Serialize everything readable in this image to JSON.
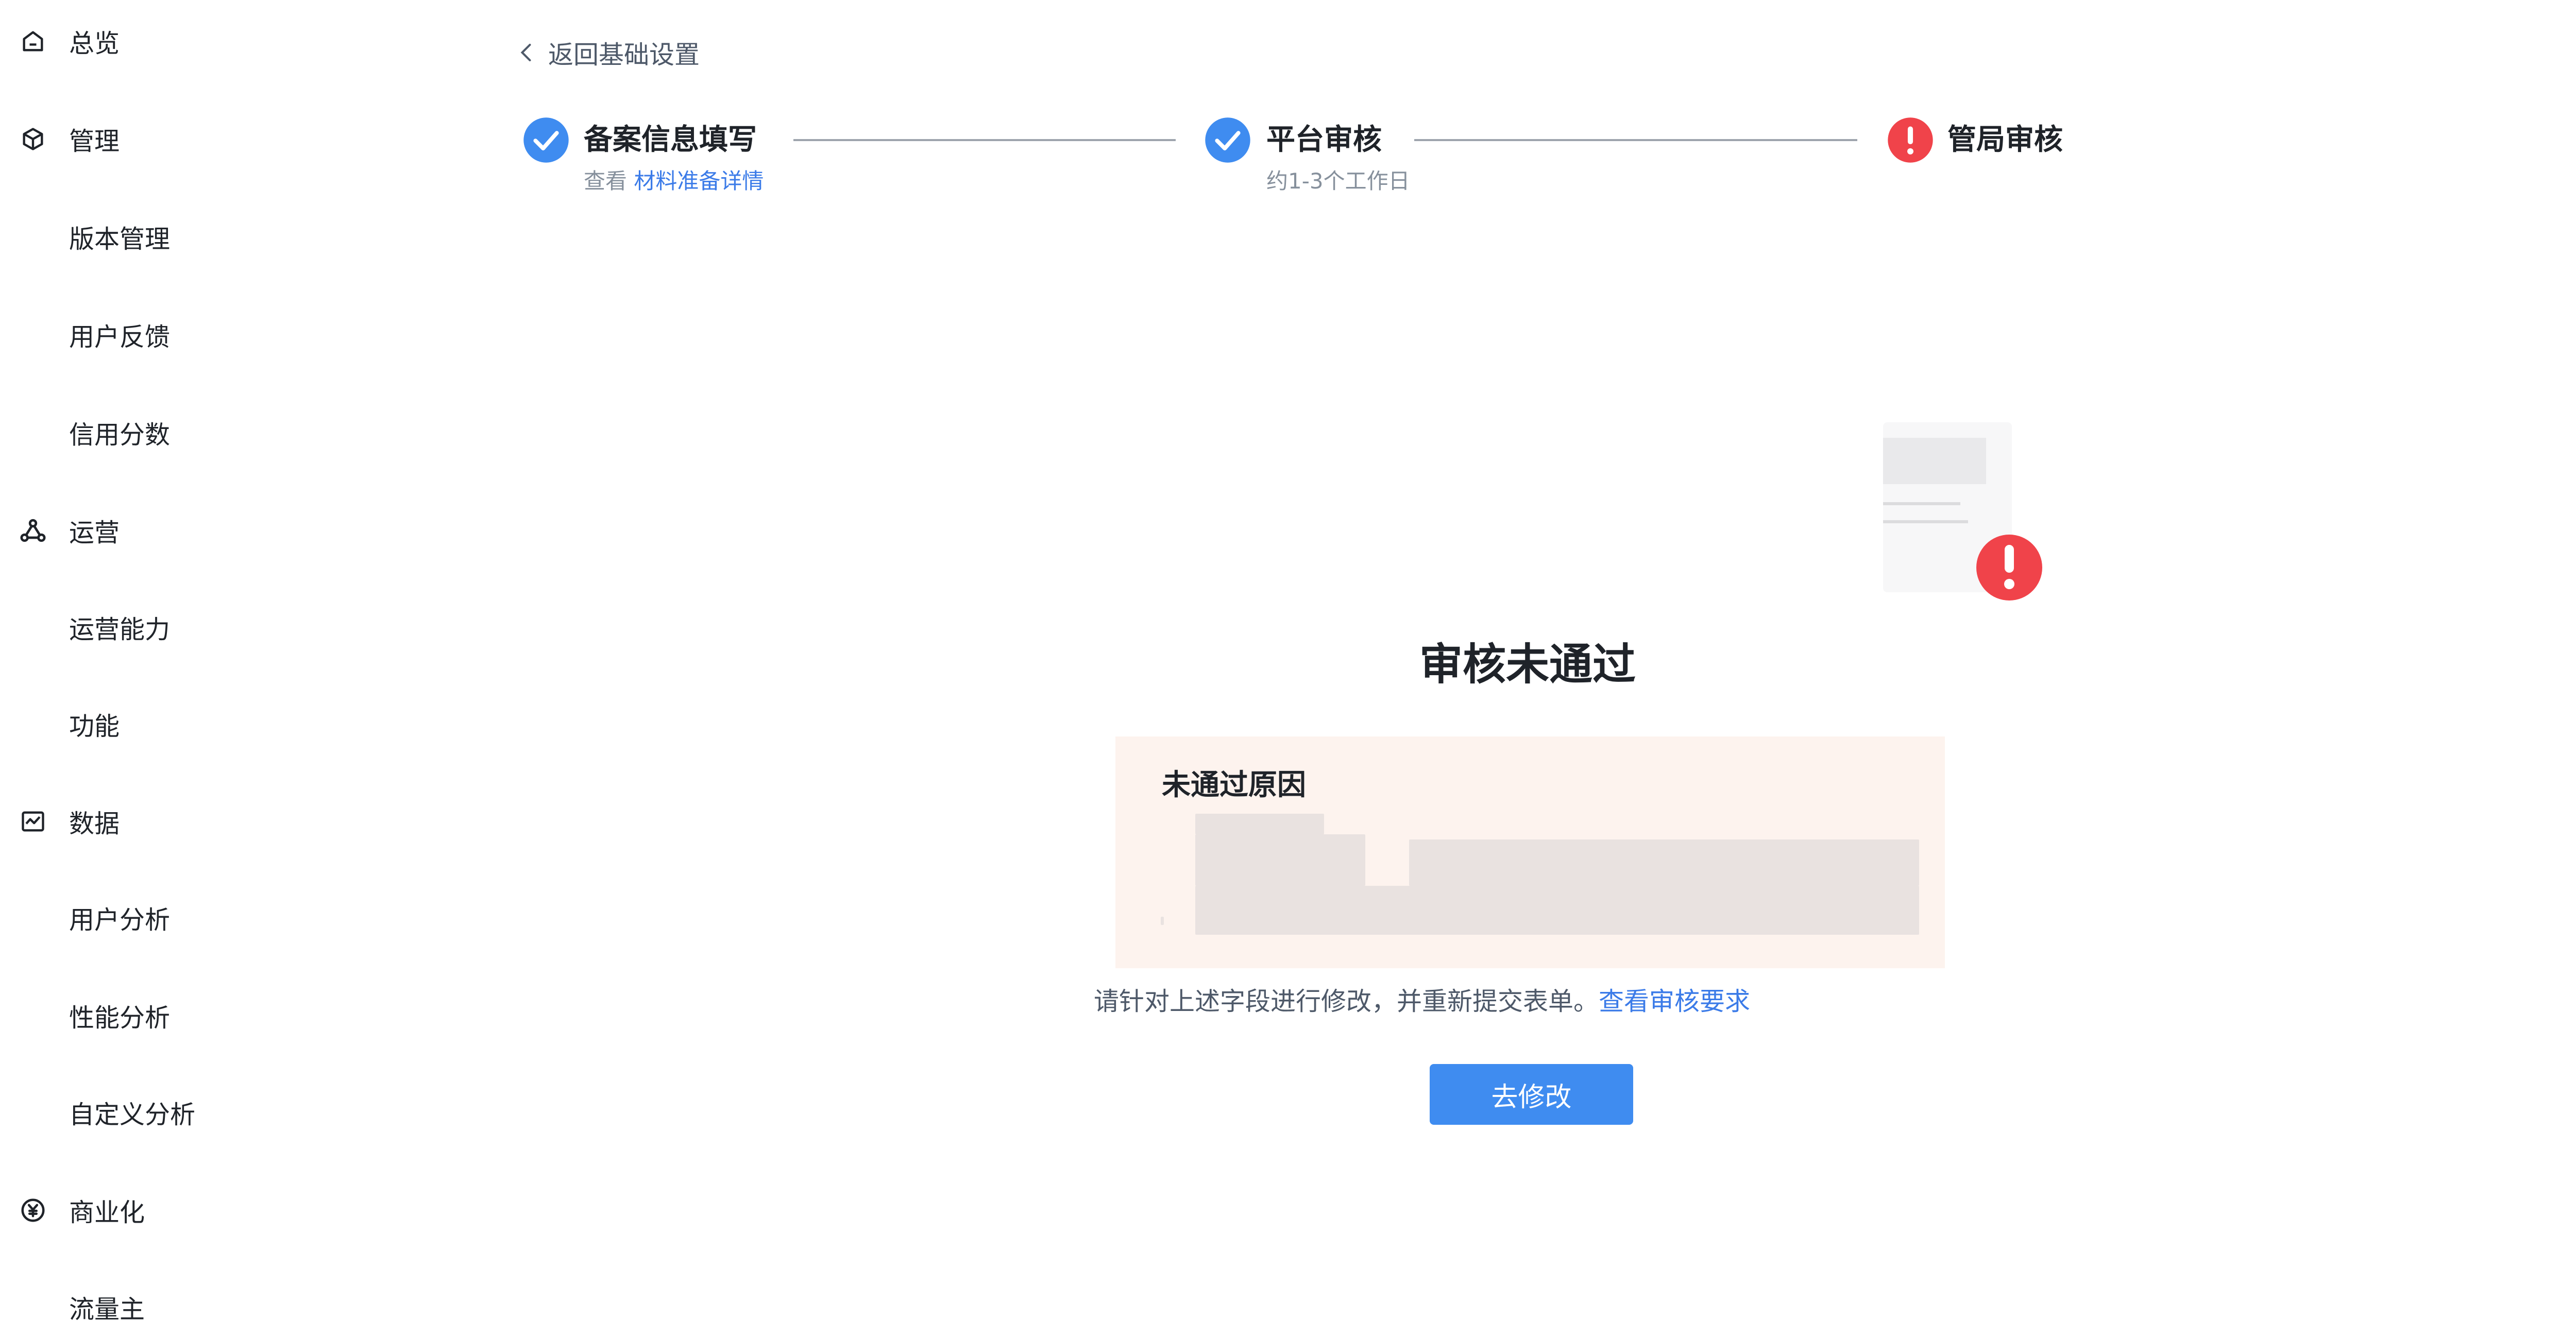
{
  "sidebar": {
    "items": [
      {
        "label": "总览",
        "icon": "home-icon"
      },
      {
        "label": "管理",
        "icon": "cube-icon"
      },
      {
        "label": "版本管理",
        "icon": ""
      },
      {
        "label": "用户反馈",
        "icon": ""
      },
      {
        "label": "信用分数",
        "icon": ""
      },
      {
        "label": "运营",
        "icon": "operation-icon"
      },
      {
        "label": "运营能力",
        "icon": ""
      },
      {
        "label": "功能",
        "icon": ""
      },
      {
        "label": "数据",
        "icon": "chart-icon"
      },
      {
        "label": "用户分析",
        "icon": ""
      },
      {
        "label": "性能分析",
        "icon": ""
      },
      {
        "label": "自定义分析",
        "icon": ""
      },
      {
        "label": "商业化",
        "icon": "yuan-icon"
      },
      {
        "label": "流量主",
        "icon": ""
      }
    ]
  },
  "main": {
    "back_label": "返回基础设置",
    "steps": [
      {
        "title": "备案信息填写",
        "sub_prefix": "查看 ",
        "sub_link": "材料准备详情",
        "status": "done"
      },
      {
        "title": "平台审核",
        "sub": "约1-3个工作日",
        "status": "done"
      },
      {
        "title": "管局审核",
        "status": "error"
      }
    ],
    "result_title": "审核未通过",
    "reason": {
      "title": "未通过原因",
      "content": "[redacted]"
    },
    "hint_text": "请针对上述字段进行修改，并重新提交表单。",
    "hint_link": "查看审核要求",
    "action_label": "去修改"
  },
  "colors": {
    "accent": "#3f8cf0",
    "link": "#3b7be8",
    "success_step": "#3f8cf0",
    "error": "#f0434a",
    "reason_bg": "#fdf3ee"
  }
}
